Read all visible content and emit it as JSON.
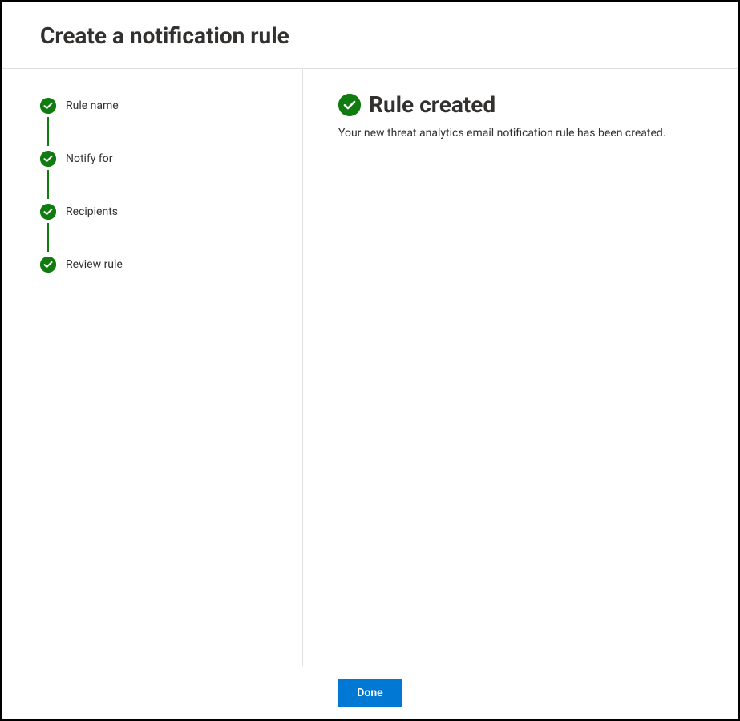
{
  "header": {
    "title": "Create a notification rule"
  },
  "sidebar": {
    "steps": [
      {
        "label": "Rule name",
        "completed": true
      },
      {
        "label": "Notify for",
        "completed": true
      },
      {
        "label": "Recipients",
        "completed": true
      },
      {
        "label": "Review rule",
        "completed": true
      }
    ]
  },
  "main": {
    "heading": "Rule created",
    "description": "Your new threat analytics email notification rule has been created."
  },
  "footer": {
    "done_label": "Done"
  },
  "colors": {
    "success": "#107c10",
    "primary": "#0078d4"
  }
}
